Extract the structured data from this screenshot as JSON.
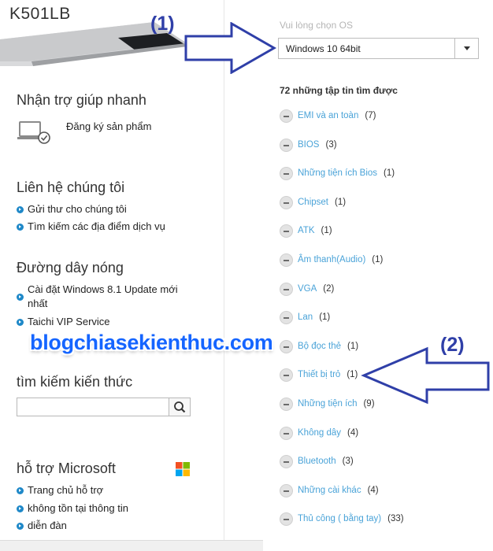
{
  "product": {
    "model": "K501LB"
  },
  "quick_help": {
    "title": "Nhận trợ giúp nhanh",
    "register_label": "Đăng ký sản phẩm"
  },
  "contact": {
    "title": "Liên hệ chúng tôi",
    "links": [
      "Gửi thư cho chúng tôi",
      "Tìm kiếm các địa điểm dịch vụ"
    ]
  },
  "hotline": {
    "title": "Đường dây nóng",
    "links": [
      "Cài đặt Windows 8.1 Update mới nhất",
      "Taichi VIP Service"
    ]
  },
  "knowledge_search": {
    "title": "tìm kiếm kiến thức",
    "placeholder": ""
  },
  "microsoft": {
    "title": "hỗ trợ Microsoft",
    "links": [
      "Trang chủ hỗ trợ",
      "không tồn tại thông tin",
      "diễn đàn"
    ]
  },
  "watermark": "blogchiasekienthuc.com",
  "os_selector": {
    "label": "Vui lòng chọn OS",
    "selected": "Windows 10 64bit"
  },
  "files_count": "72 những tập tin tìm được",
  "categories": [
    {
      "name": "EMI và an toàn",
      "count": "(7)"
    },
    {
      "name": "BIOS",
      "count": "(3)"
    },
    {
      "name": "Những tiện ích Bios",
      "count": "(1)"
    },
    {
      "name": "Chipset",
      "count": "(1)"
    },
    {
      "name": "ATK",
      "count": "(1)"
    },
    {
      "name": "Âm thanh(Audio)",
      "count": "(1)"
    },
    {
      "name": "VGA",
      "count": "(2)"
    },
    {
      "name": "Lan",
      "count": "(1)"
    },
    {
      "name": "Bộ đọc thẻ",
      "count": "(1)"
    },
    {
      "name": "Thiết bị trỏ",
      "count": "(1)"
    },
    {
      "name": "Những tiện ích",
      "count": "(9)"
    },
    {
      "name": "Không dây",
      "count": "(4)"
    },
    {
      "name": "Bluetooth",
      "count": "(3)"
    },
    {
      "name": "Những cài khác",
      "count": "(4)"
    },
    {
      "name": "Thủ công ( bằng tay)",
      "count": "(33)"
    }
  ],
  "annotations": {
    "one": "(1)",
    "two": "(2)"
  },
  "colors": {
    "link_blue": "#4aa3d8",
    "bullet_blue": "#1e88c8",
    "annotation": "#2f3fa8",
    "watermark": "#1565ff"
  },
  "icons": {
    "search": "search-icon",
    "dropdown": "chevron-down-icon",
    "register": "laptop-check-icon",
    "microsoft": "windows-logo-icon",
    "collapse": "minus-circle-icon"
  }
}
